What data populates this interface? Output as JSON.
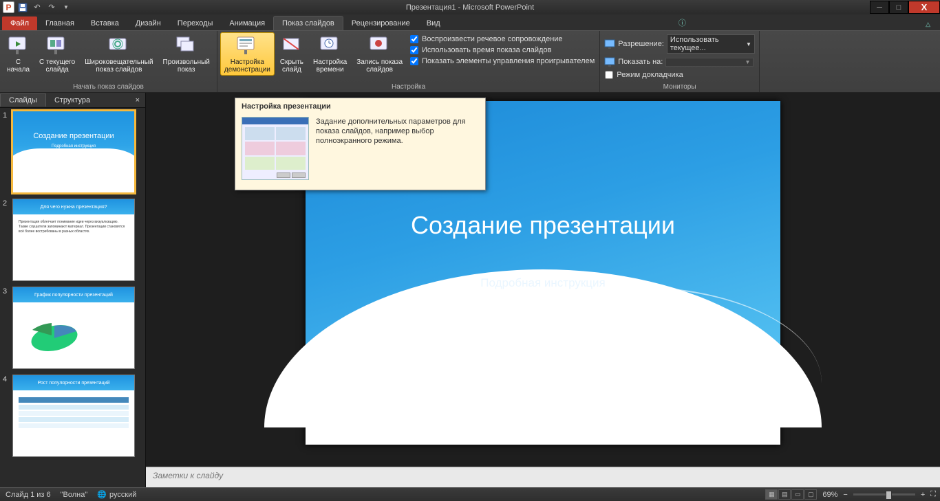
{
  "title": "Презентация1 - Microsoft PowerPoint",
  "qat": {
    "save": "💾",
    "undo": "↶",
    "redo": "↷"
  },
  "tabs": {
    "file": "Файл",
    "items": [
      "Главная",
      "Вставка",
      "Дизайн",
      "Переходы",
      "Анимация",
      "Показ слайдов",
      "Рецензирование",
      "Вид"
    ],
    "activeIndex": 5
  },
  "ribbon": {
    "group1": {
      "label": "Начать показ слайдов",
      "b1": "С\nначала",
      "b2": "С текущего\nслайда",
      "b3": "Широковещательный\nпоказ слайдов",
      "b4": "Произвольный\nпоказ"
    },
    "group2": {
      "label": "Настройка",
      "b1": "Настройка\nдемонстрации",
      "b2": "Скрыть\nслайд",
      "b3": "Настройка\nвремени",
      "b4": "Запись показа\nслайдов",
      "c1": "Воспроизвести речевое сопровождение",
      "c2": "Использовать время показа слайдов",
      "c3": "Показать элементы управления проигрывателем"
    },
    "group3": {
      "label": "Мониторы",
      "r1": "Разрешение:",
      "r1v": "Использовать текущее...",
      "r2": "Показать на:",
      "r2v": "",
      "c1": "Режим докладчика"
    }
  },
  "tooltip": {
    "title": "Настройка презентации",
    "body": "Задание дополнительных параметров для показа слайдов, например выбор полноэкранного режима."
  },
  "slidePanel": {
    "tabs": [
      "Слайды",
      "Структура"
    ],
    "thumbs": [
      {
        "n": "1",
        "title": "Создание презентации",
        "sub": "Подробная инструкция"
      },
      {
        "n": "2",
        "title": "Для чего нужна презентация?"
      },
      {
        "n": "3",
        "title": "График популярности презентаций"
      },
      {
        "n": "4",
        "title": "Рост популярности презентаций"
      }
    ]
  },
  "slide": {
    "title": "Создание презентации",
    "sub": "Подробная инструкция"
  },
  "notes": "Заметки к слайду",
  "status": {
    "left1": "Слайд 1 из 6",
    "left2": "\"Волна\"",
    "lang": "русский",
    "zoom": "69%"
  }
}
